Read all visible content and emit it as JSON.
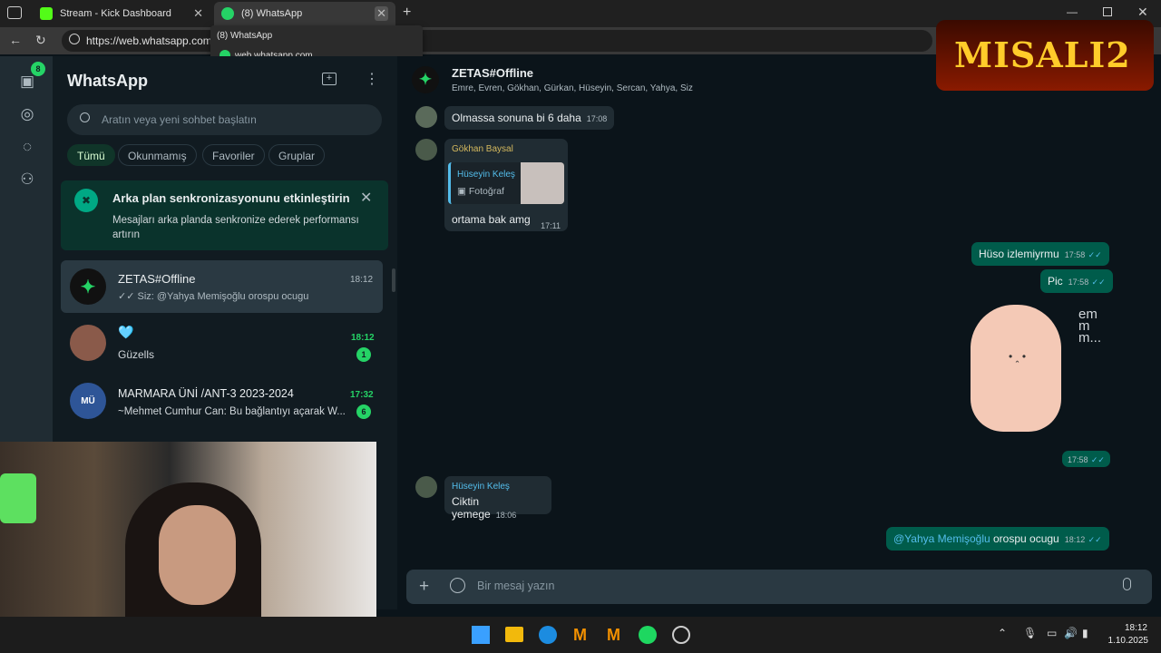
{
  "browser": {
    "tabs": [
      {
        "label": "Stream - Kick Dashboard",
        "favicon_color": "#53fc18"
      },
      {
        "label": "(8) WhatsApp",
        "favicon_color": "#25d366"
      }
    ],
    "url": "https://web.whatsapp.com",
    "hover_popup": {
      "title": "(8) WhatsApp",
      "url": "web.whatsapp.com"
    }
  },
  "rail": {
    "unread_badge": "8"
  },
  "sidebar": {
    "title": "WhatsApp",
    "search_placeholder": "Aratın veya yeni sohbet başlatın",
    "filters": [
      "Tümü",
      "Okunmamış",
      "Favoriler",
      "Gruplar"
    ],
    "banner": {
      "title": "Arka plan senkronizasyonunu etkinleştirin",
      "text": "Mesajları arka planda senkronize ederek performansı artırın"
    },
    "chats": [
      {
        "name": "ZETAS#Offline",
        "time": "18:12",
        "preview": "Siz: @Yahya Memişoğlu orospu ocugu",
        "unread": ""
      },
      {
        "name": "🩵",
        "time": "18:12",
        "preview": "Güzells",
        "unread": "1"
      },
      {
        "name": "MARMARA ÜNİ /ANT-3 2023-2024",
        "time": "17:32",
        "preview": "~Mehmet Cumhur Can: Bu bağlantıyı açarak W...",
        "unread": "6"
      }
    ]
  },
  "chat": {
    "title": "ZETAS#Offline",
    "members": "Emre, Evren, Gökhan, Gürkan, Hüseyin, Sercan, Yahya, Siz",
    "messages": [
      {
        "text": "Olmassa sonuna bi 6 daha",
        "time": "17:08"
      },
      {
        "sender": "Gökhan Baysal",
        "quote_author": "Hüseyin Keleş",
        "quote_text": "Fotoğraf",
        "text": "ortama bak amg",
        "time": "17:11"
      },
      {
        "text": "Hüso izlemiyrmu",
        "time": "17:58"
      },
      {
        "text": "Pic",
        "time": "17:58"
      },
      {
        "sticker_text": "emmm...",
        "time": "17:58"
      },
      {
        "sender": "Hüseyin Keleş",
        "text": "Ciktin yemege",
        "time": "18:06"
      },
      {
        "mention": "@Yahya Memişoğlu",
        "text": " orospu ocugu",
        "time": "18:12"
      }
    ],
    "composer_placeholder": "Bir mesaj yazın"
  },
  "overlay_logo": "MISALI2",
  "taskbar": {
    "time": "18:12",
    "date": "1.10.2025"
  },
  "colors": {
    "accent": "#00a884",
    "unread": "#25d366",
    "outgoing": "#005c4b",
    "incoming": "#202c33",
    "sender_gokhan": "#d4b95e",
    "sender_huseyin": "#53bdeb",
    "mention": "#53bdeb"
  }
}
